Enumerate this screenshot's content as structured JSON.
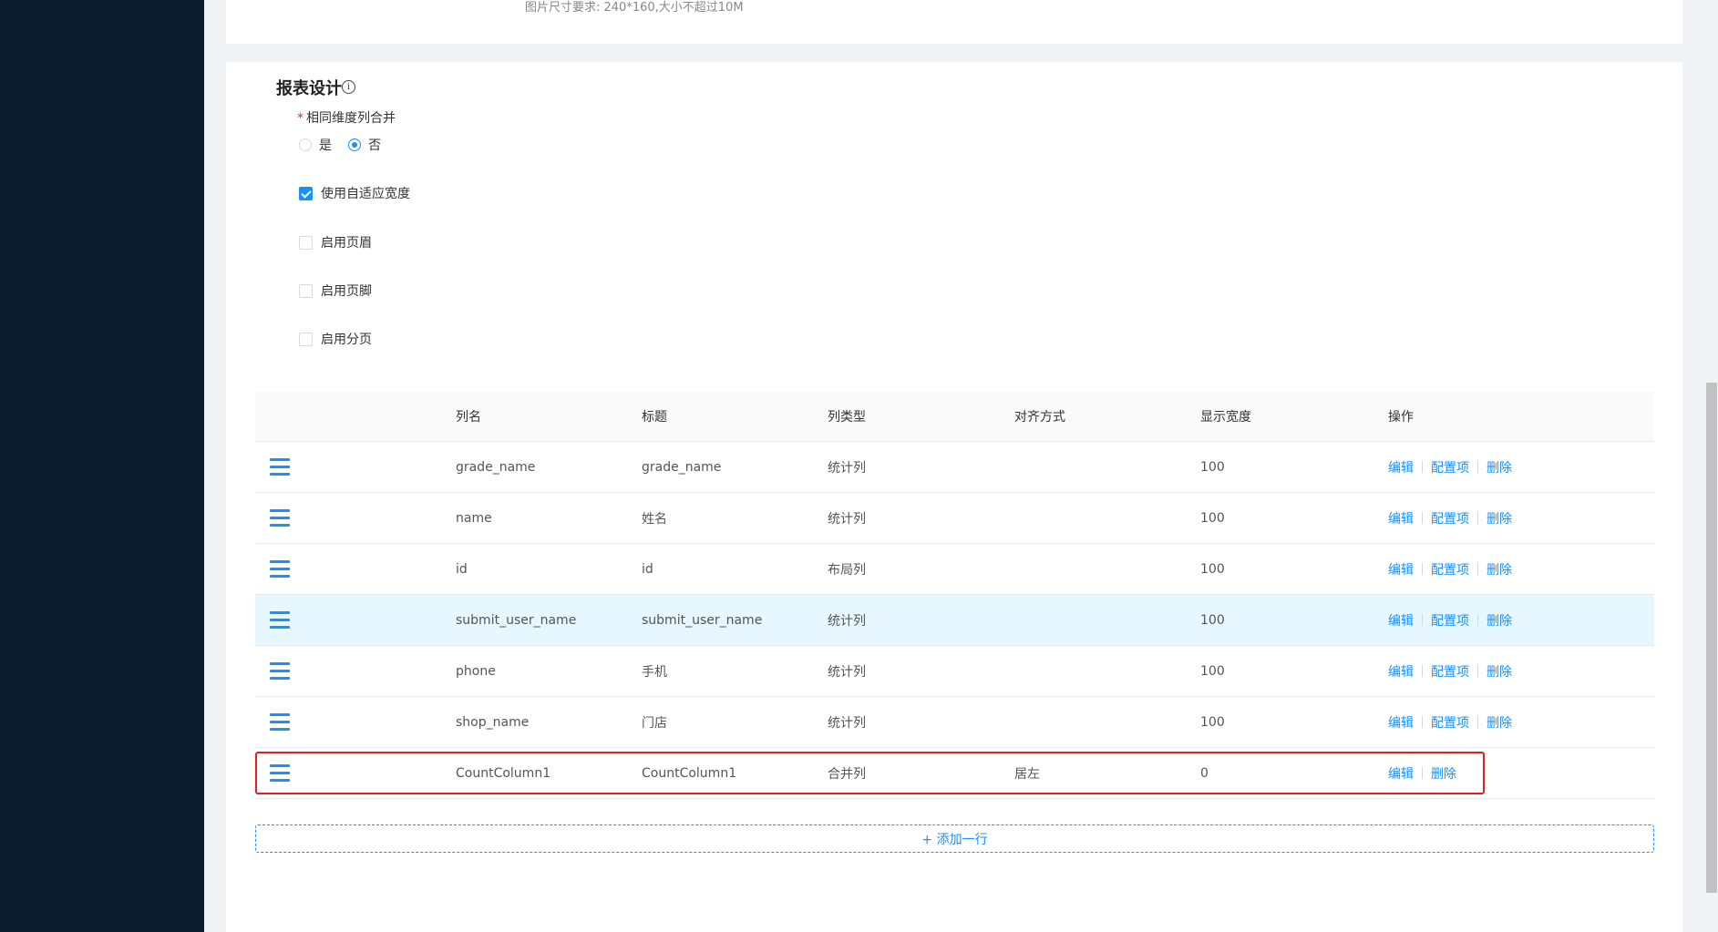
{
  "top_hint": "图片尺寸要求: 240*160,大小不超过10M",
  "section": {
    "title": "报表设计",
    "info_icon": "info-circle-icon"
  },
  "merge_field": {
    "required_mark": "*",
    "label": "相同维度列合并",
    "options": [
      {
        "label": "是",
        "checked": false
      },
      {
        "label": "否",
        "checked": true
      }
    ]
  },
  "checkboxes": [
    {
      "label": "使用自适应宽度",
      "checked": true
    },
    {
      "label": "启用页眉",
      "checked": false
    },
    {
      "label": "启用页脚",
      "checked": false
    },
    {
      "label": "启用分页",
      "checked": false
    }
  ],
  "table": {
    "columns": [
      "列名",
      "标题",
      "列类型",
      "对齐方式",
      "显示宽度",
      "操作"
    ],
    "rows": [
      {
        "name": "grade_name",
        "title": "grade_name",
        "type": "统计列",
        "align": "",
        "width": "100",
        "ops": [
          "编辑",
          "配置项",
          "删除"
        ]
      },
      {
        "name": "name",
        "title": "姓名",
        "type": "统计列",
        "align": "",
        "width": "100",
        "ops": [
          "编辑",
          "配置项",
          "删除"
        ]
      },
      {
        "name": "id",
        "title": "id",
        "type": "布局列",
        "align": "",
        "width": "100",
        "ops": [
          "编辑",
          "配置项",
          "删除"
        ]
      },
      {
        "name": "submit_user_name",
        "title": "submit_user_name",
        "type": "统计列",
        "align": "",
        "width": "100",
        "ops": [
          "编辑",
          "配置项",
          "删除"
        ],
        "highlighted": true
      },
      {
        "name": "phone",
        "title": "手机",
        "type": "统计列",
        "align": "",
        "width": "100",
        "ops": [
          "编辑",
          "配置项",
          "删除"
        ]
      },
      {
        "name": "shop_name",
        "title": "门店",
        "type": "统计列",
        "align": "",
        "width": "100",
        "ops": [
          "编辑",
          "配置项",
          "删除"
        ]
      },
      {
        "name": "CountColumn1",
        "title": "CountColumn1",
        "type": "合并列",
        "align": "居左",
        "width": "0",
        "ops": [
          "编辑",
          "删除"
        ]
      }
    ]
  },
  "add_row_label": "+ 添加一行",
  "colors": {
    "accent": "#1890ff",
    "sidebar": "#0b1b2d",
    "highlight_row": "#e6f7ff",
    "annotation_box": "#e02020"
  }
}
